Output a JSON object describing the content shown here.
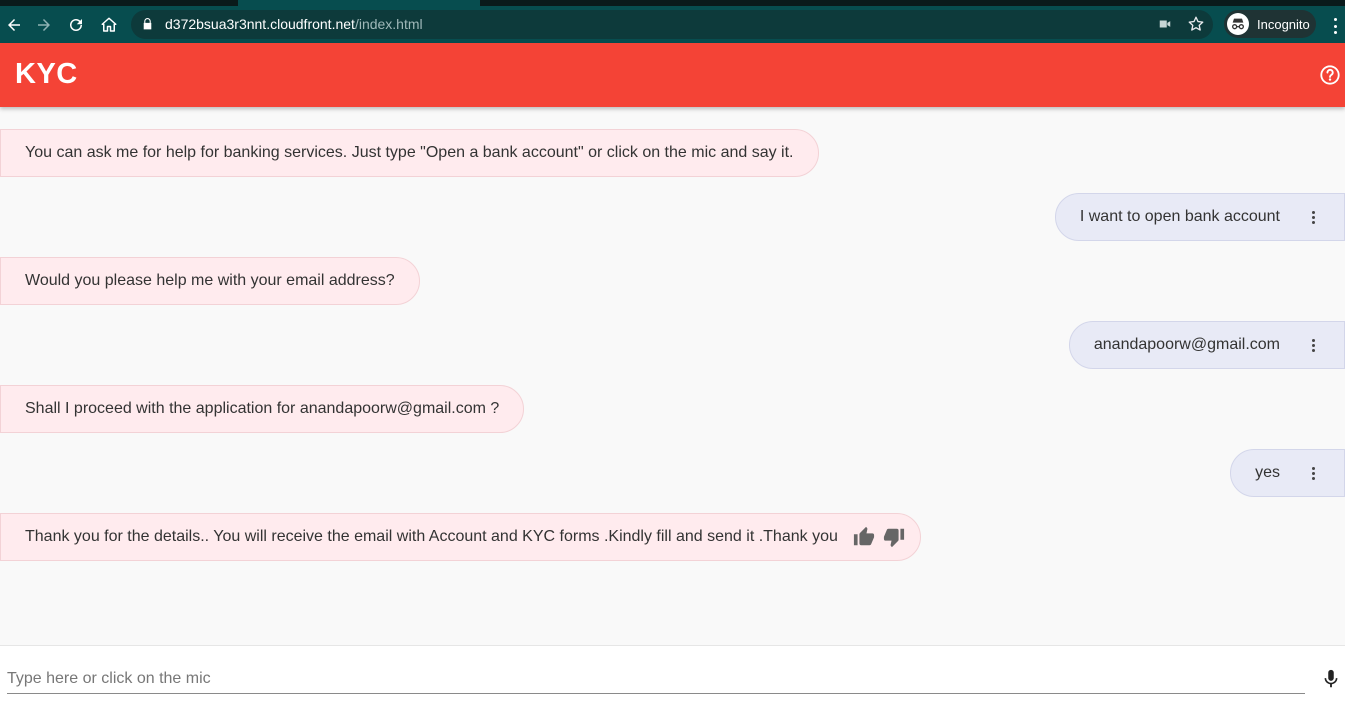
{
  "browser": {
    "url_host": "d372bsua3r3nnt.cloudfront.net",
    "url_path": "/index.html",
    "profile_label": "Incognito",
    "toolbar_color": "#074d4f"
  },
  "header": {
    "title": "KYC",
    "color": "#f44336",
    "help_icon": "help-circle-icon"
  },
  "conversation": [
    {
      "sender": "bot",
      "text": "You can ask me for help for banking services. Just type \"Open a bank account\" or click on the mic and say it."
    },
    {
      "sender": "user",
      "text": "I want to open bank account"
    },
    {
      "sender": "bot",
      "text": "Would you please help me with your email address?"
    },
    {
      "sender": "user",
      "text": "anandapoorw@gmail.com"
    },
    {
      "sender": "bot",
      "text": "Shall I proceed with the application for anandapoorw@gmail.com ?"
    },
    {
      "sender": "user",
      "text": "yes"
    },
    {
      "sender": "bot",
      "text": "Thank you for the details.. You will receive the email with Account and KYC forms .Kindly fill and send it .Thank you",
      "feedback": [
        "thumb-up-icon",
        "thumb-down-icon"
      ]
    }
  ],
  "colors": {
    "bot_bubble": "#ffebee",
    "user_bubble": "#e8eaf6"
  },
  "input": {
    "placeholder": "Type here or click on the mic",
    "value": ""
  }
}
